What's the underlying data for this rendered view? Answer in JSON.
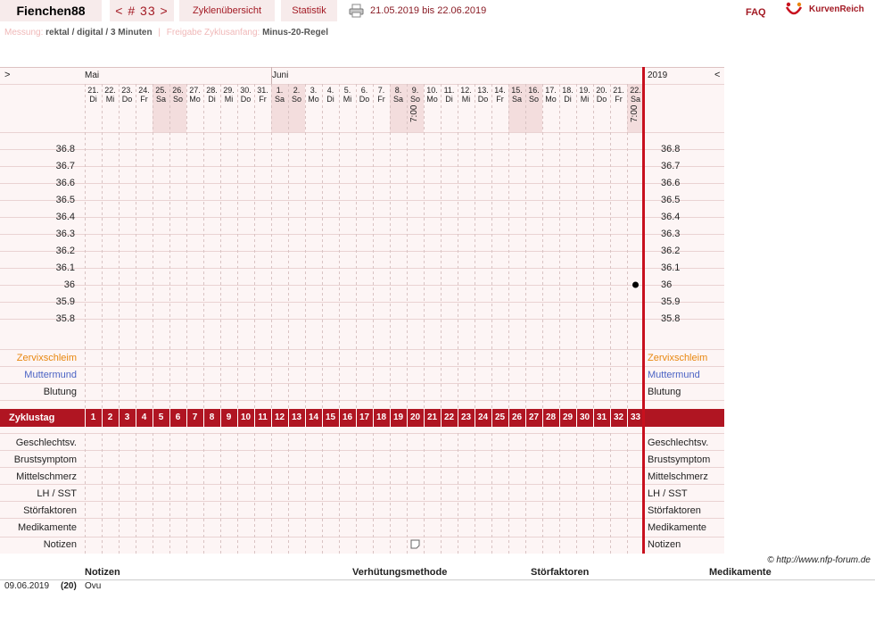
{
  "header": {
    "user_name": "Fienchen88",
    "cycle_nav": "< # 33 >",
    "tabs": [
      "Zyklenübersicht",
      "Statistik"
    ],
    "date_range": "21.05.2019 bis 22.06.2019",
    "faq": "FAQ",
    "logo_text": "KurvenReich",
    "icons": {
      "print": "printer-icon",
      "logo": "kurvenreich-logo-icon"
    }
  },
  "info": {
    "measurement_label": "Messung:",
    "measurement_value": "rektal / digital / 3 Minuten",
    "release_label": "Freigabe Zyklusanfang:",
    "release_value": "Minus-20-Regel"
  },
  "chart": {
    "nav_left": ">",
    "nav_right": "<",
    "months": [
      "Mai",
      "Juni"
    ],
    "year": "2019",
    "days": [
      {
        "d": "21.",
        "w": "Di"
      },
      {
        "d": "22.",
        "w": "Mi"
      },
      {
        "d": "23.",
        "w": "Do"
      },
      {
        "d": "24.",
        "w": "Fr"
      },
      {
        "d": "25.",
        "w": "Sa",
        "we": true
      },
      {
        "d": "26.",
        "w": "So",
        "we": true
      },
      {
        "d": "27.",
        "w": "Mo"
      },
      {
        "d": "28.",
        "w": "Di"
      },
      {
        "d": "29.",
        "w": "Mi"
      },
      {
        "d": "30.",
        "w": "Do"
      },
      {
        "d": "31.",
        "w": "Fr"
      },
      {
        "d": "1.",
        "w": "Sa",
        "we": true
      },
      {
        "d": "2.",
        "w": "So",
        "we": true
      },
      {
        "d": "3.",
        "w": "Mo"
      },
      {
        "d": "4.",
        "w": "Di"
      },
      {
        "d": "5.",
        "w": "Mi"
      },
      {
        "d": "6.",
        "w": "Do"
      },
      {
        "d": "7.",
        "w": "Fr"
      },
      {
        "d": "8.",
        "w": "Sa",
        "we": true
      },
      {
        "d": "9.",
        "w": "So",
        "we": true,
        "time": "7:00"
      },
      {
        "d": "10.",
        "w": "Mo"
      },
      {
        "d": "11.",
        "w": "Di"
      },
      {
        "d": "12.",
        "w": "Mi"
      },
      {
        "d": "13.",
        "w": "Do"
      },
      {
        "d": "14.",
        "w": "Fr"
      },
      {
        "d": "15.",
        "w": "Sa",
        "we": true
      },
      {
        "d": "16.",
        "w": "So",
        "we": true
      },
      {
        "d": "17.",
        "w": "Mo"
      },
      {
        "d": "18.",
        "w": "Di"
      },
      {
        "d": "19.",
        "w": "Mi"
      },
      {
        "d": "20.",
        "w": "Do"
      },
      {
        "d": "21.",
        "w": "Fr"
      },
      {
        "d": "22.",
        "w": "Sa",
        "we": true,
        "time": "7:00"
      }
    ],
    "temp_ticks": [
      "36.8",
      "36.7",
      "36.6",
      "36.5",
      "36.4",
      "36.3",
      "36.2",
      "36.1",
      "36",
      "35.9",
      "35.8"
    ],
    "measurement_points": [
      {
        "cycle_day": 33,
        "temp": 36.0
      }
    ],
    "symptom_rows": [
      {
        "label": "Zervixschleim",
        "color": "#e8870f"
      },
      {
        "label": "Muttermund",
        "color": "#4a63c4"
      },
      {
        "label": "Blutung",
        "color": "#222222"
      }
    ],
    "cycle_day_label": "Zyklustag",
    "cycle_days": [
      "1",
      "2",
      "3",
      "4",
      "5",
      "6",
      "7",
      "8",
      "9",
      "10",
      "11",
      "12",
      "13",
      "14",
      "15",
      "16",
      "17",
      "18",
      "19",
      "20",
      "21",
      "22",
      "23",
      "24",
      "25",
      "26",
      "27",
      "28",
      "29",
      "30",
      "31",
      "32",
      "33"
    ],
    "bottom_rows": [
      "Geschlechtsv.",
      "Brustsymptom",
      "Mittelschmerz",
      "LH / SST",
      "Störfaktoren",
      "Medikamente",
      "Notizen"
    ],
    "note_icon_cycle_day": 20,
    "accent": "#b01522",
    "weekend_bg": "#f3dddd"
  },
  "footer": {
    "copyright": "© http://www.nfp-forum.de",
    "columns": [
      "Notizen",
      "Verhütungsmethode",
      "Störfaktoren",
      "Medikamente"
    ],
    "notes": [
      {
        "date": "09.06.2019",
        "day": "(20)",
        "text": "Ovu"
      }
    ]
  }
}
